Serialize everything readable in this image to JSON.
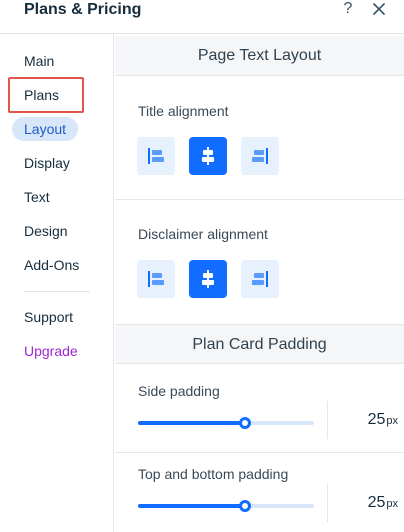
{
  "header": {
    "title": "Plans & Pricing",
    "help_label": "?",
    "close_icon": "close-icon"
  },
  "sidebar": {
    "items": [
      {
        "label": "Main"
      },
      {
        "label": "Plans"
      },
      {
        "label": "Layout",
        "active": true
      },
      {
        "label": "Display"
      },
      {
        "label": "Text"
      },
      {
        "label": "Design"
      },
      {
        "label": "Add-Ons"
      }
    ],
    "secondary": [
      {
        "label": "Support"
      },
      {
        "label": "Upgrade",
        "color": "#9a27d5"
      }
    ]
  },
  "main": {
    "page_text_layout": {
      "heading": "Page Text Layout",
      "title_alignment": {
        "label": "Title alignment",
        "options": [
          "align-left-icon",
          "align-center-icon",
          "align-right-icon"
        ],
        "selected": "center"
      },
      "disclaimer_alignment": {
        "label": "Disclaimer alignment",
        "options": [
          "align-left-icon",
          "align-center-icon",
          "align-right-icon"
        ],
        "selected": "center"
      }
    },
    "plan_card_padding": {
      "heading": "Plan Card Padding",
      "side_padding": {
        "label": "Side padding",
        "value": "25",
        "unit": "px",
        "fill_fraction": 0.61
      },
      "top_bottom_padding": {
        "label": "Top and bottom padding",
        "value": "25",
        "unit": "px",
        "fill_fraction": 0.61
      }
    }
  },
  "colors": {
    "accent": "#116dff",
    "accent_light": "#e7f0fd",
    "active_nav_bg": "#d8e6fa",
    "active_nav_text": "#1c5cc7",
    "highlight_frame": "#e2554b",
    "upgrade": "#9a27d5"
  }
}
